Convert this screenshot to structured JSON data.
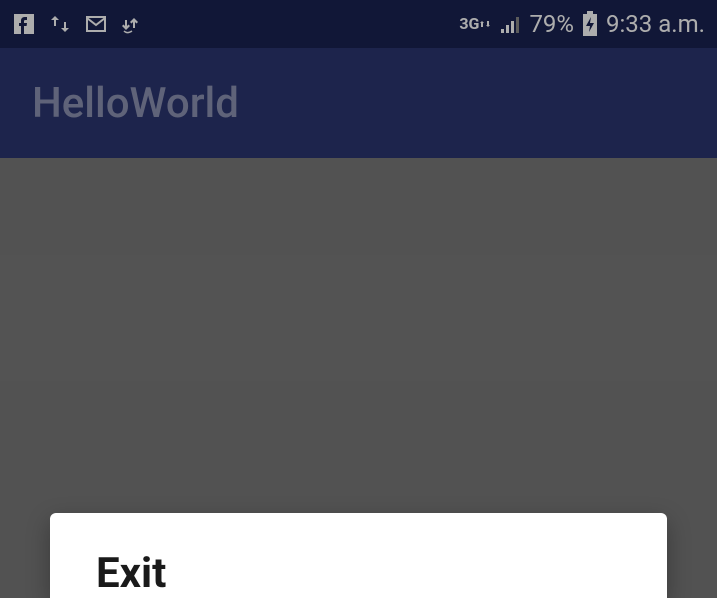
{
  "status_bar": {
    "network_label": "3G",
    "battery_percent": "79%",
    "time": "9:33 a.m."
  },
  "app_bar": {
    "title": "HelloWorld"
  },
  "dialog": {
    "title": "Exit"
  }
}
